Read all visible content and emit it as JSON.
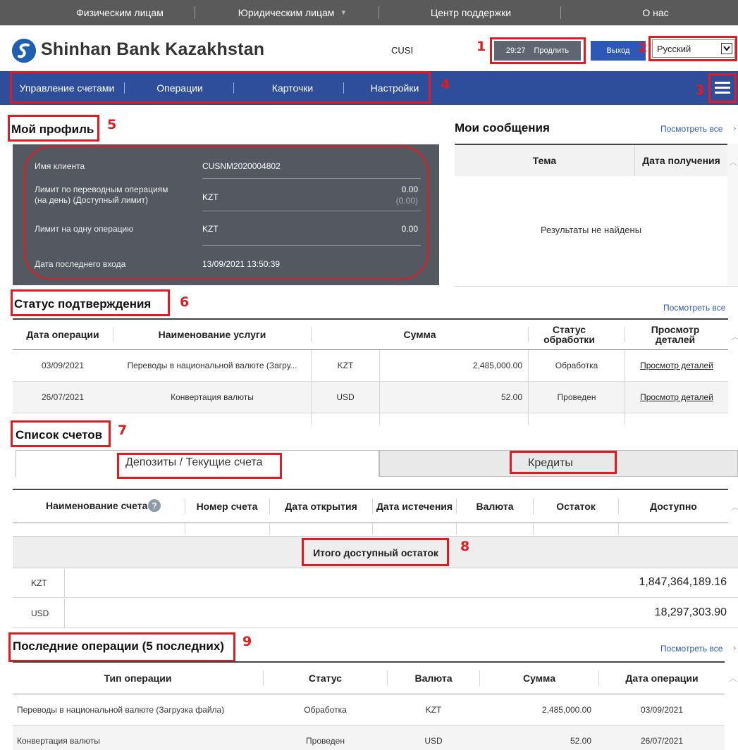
{
  "topnav": {
    "items": [
      "Физическим лицам",
      "Юридическим лицам",
      "Центр поддержки",
      "О нас"
    ],
    "dropdown_glyph": "▼"
  },
  "header": {
    "brand": "Shinhan Bank Kazakhstan",
    "user_id": "CUSI",
    "session_timer": "29:27",
    "extend_label": "Продлить",
    "logout_label": "Выход",
    "language": "Русский"
  },
  "mainnav": {
    "items": [
      "Управление счетами",
      "Операции",
      "Карточки",
      "Настройки"
    ]
  },
  "profile": {
    "title": "Мой профиль",
    "rows": [
      {
        "label": "Имя клиента",
        "value": "CUSNM2020004802"
      },
      {
        "label": "Лимит по переводным операциям (на день) (Доступный лимит)",
        "currency": "KZT",
        "amount": "0.00",
        "available": "(0.00)"
      },
      {
        "label": "Лимит на одну операцию",
        "currency": "KZT",
        "amount": "0.00"
      },
      {
        "label": "Дата последнего входа",
        "value": "13/09/2021 13:50:39"
      }
    ]
  },
  "messages": {
    "title": "Мои сообщения",
    "view_all": "Посмотреть все",
    "col_subject": "Тема",
    "col_date": "Дата получения",
    "empty": "Результаты не найдены"
  },
  "confirmation": {
    "title": "Статус подтверждения",
    "view_all": "Посмотреть все",
    "headers": {
      "date": "Дата операции",
      "service": "Наименование услуги",
      "amount": "Сумма",
      "status": "Статус обработки",
      "details": "Просмотр деталей"
    },
    "rows": [
      {
        "date": "03/09/2021",
        "service": "Переводы в национальной валюте (Загру...",
        "currency": "KZT",
        "amount": "2,485,000.00",
        "status": "Обработка",
        "details": "Просмотр деталей"
      },
      {
        "date": "26/07/2021",
        "service": "Конвертация валюты",
        "currency": "USD",
        "amount": "52.00",
        "status": "Проведен",
        "details": "Просмотр деталей"
      }
    ]
  },
  "accounts": {
    "title": "Список счетов",
    "tab_deposits": "Депозиты / Текущие счета",
    "tab_credits": "Кредиты",
    "headers": {
      "name": "Наименование счета",
      "number": "Номер счета",
      "opened": "Дата открытия",
      "expiry": "Дата истечения",
      "currency": "Валюта",
      "balance": "Остаток",
      "available": "Доступно"
    },
    "help_glyph": "?",
    "total_label": "Итого доступный остаток",
    "totals": [
      {
        "currency": "KZT",
        "amount": "1,847,364,189.16"
      },
      {
        "currency": "USD",
        "amount": "18,297,303.90"
      }
    ]
  },
  "recent": {
    "title": "Последние операции (5 последних)",
    "view_all": "Посмотреть все",
    "headers": {
      "type": "Тип операции",
      "status": "Статус",
      "currency": "Валюта",
      "amount": "Сумма",
      "date": "Дата операции"
    },
    "rows": [
      {
        "type": "Переводы в национальной валюте (Загрузка файла)",
        "status": "Обработка",
        "currency": "KZT",
        "amount": "2,485,000.00",
        "date": "03/09/2021"
      },
      {
        "type": "Конвертация валюты",
        "status": "Проведен",
        "currency": "USD",
        "amount": "52.00",
        "date": "26/07/2021"
      }
    ]
  },
  "annotations": [
    "1",
    "2",
    "3",
    "4",
    "5",
    "6",
    "7",
    "8",
    "9"
  ],
  "colors": {
    "annotation_red": "#e01b22",
    "nav_blue": "#2e4d9b",
    "top_gray": "#5a5a5a",
    "profile_panel": "#545861",
    "link_blue": "#2e58b8"
  }
}
